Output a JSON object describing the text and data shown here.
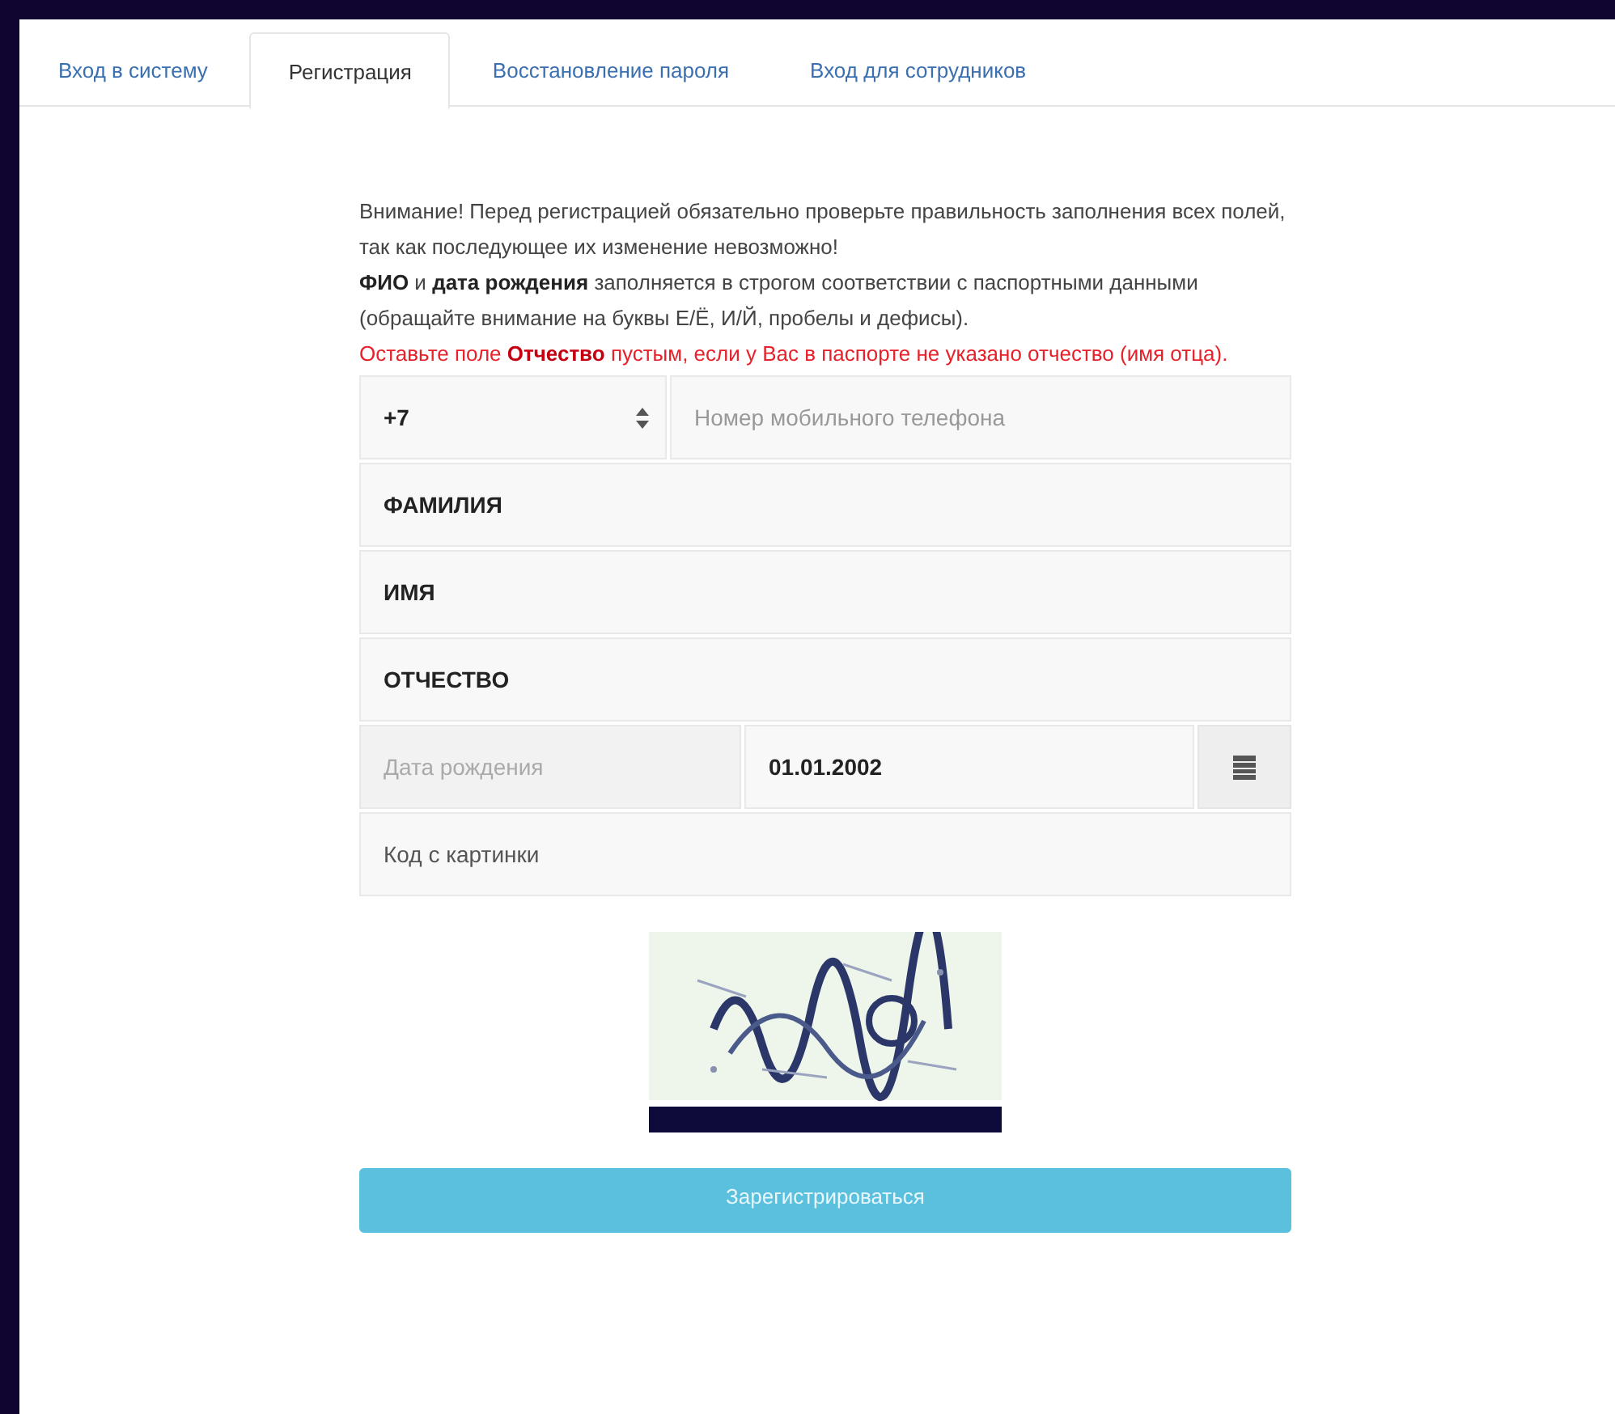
{
  "tabs": [
    {
      "label": "Вход в систему",
      "selected": false
    },
    {
      "label": "Регистрация",
      "selected": true
    },
    {
      "label": "Восстановление пароля",
      "selected": false
    },
    {
      "label": "Вход для сотрудников",
      "selected": false
    }
  ],
  "notice": [
    {
      "kind": "note",
      "text": "Внимание! Перед регистрацией обязательно проверьте правильность заполнения всех полей, так как последующее их изменение невозможно!"
    },
    {
      "kind": "note",
      "text": "**ФИО** и **дата рождения** заполняется в строгом соответствии с паспортными данными (обращайте внимание на буквы Е/Ё, И/Й, пробелы и дефисы)."
    },
    {
      "kind": "warning",
      "text": "Оставьте поле **Отчество** пустым, если у Вас в паспорте не указано отчество (имя отца)."
    }
  ],
  "fields": [
    {
      "kind": "phone",
      "code": "+7",
      "placeholder": "Номер мобильного телефона"
    },
    {
      "kind": "text",
      "value": "ФАМИЛИЯ"
    },
    {
      "kind": "text",
      "value": "ИМЯ"
    },
    {
      "kind": "text",
      "value": "ОТЧЕСТВО"
    },
    {
      "kind": "date",
      "label": "Дата рождения",
      "value": "01.01.2002"
    },
    {
      "kind": "text",
      "placeholder": "Код с картинки"
    }
  ],
  "submit": "Зарегистрироваться"
}
